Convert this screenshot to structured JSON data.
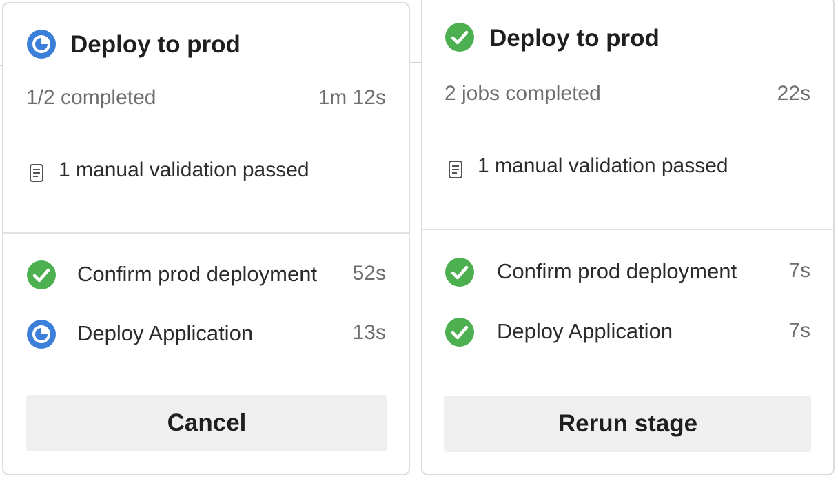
{
  "colors": {
    "running": "#3b7fd9",
    "success": "#4caf50",
    "button_bg": "#efefef",
    "muted_text": "#6e6e6e"
  },
  "stages": [
    {
      "title": "Deploy to prod",
      "status_icon": "running-icon",
      "summary": "1/2 completed",
      "duration": "1m 12s",
      "checks_icon": "checklist-icon",
      "checks": "1 manual validation passed",
      "jobs": [
        {
          "status_icon": "success-icon",
          "name": "Confirm prod deployment",
          "duration": "52s"
        },
        {
          "status_icon": "running-icon",
          "name": "Deploy Application",
          "duration": "13s"
        }
      ],
      "action_label": "Cancel"
    },
    {
      "title": "Deploy to prod",
      "status_icon": "success-icon",
      "summary": "2 jobs completed",
      "duration": "22s",
      "checks_icon": "checklist-icon",
      "checks": "1 manual validation passed",
      "jobs": [
        {
          "status_icon": "success-icon",
          "name": "Confirm prod deployment",
          "duration": "7s"
        },
        {
          "status_icon": "success-icon",
          "name": "Deploy Application",
          "duration": "7s"
        }
      ],
      "action_label": "Rerun stage"
    }
  ]
}
